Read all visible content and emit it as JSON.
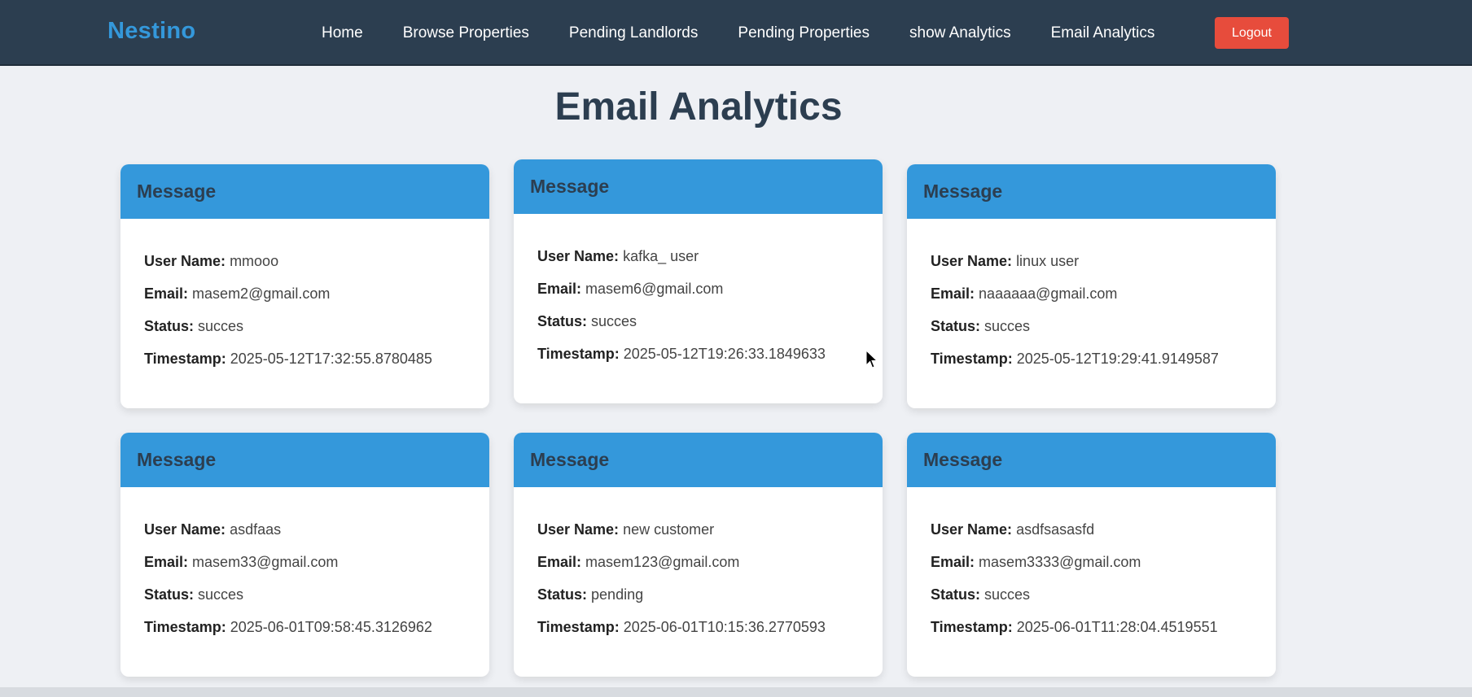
{
  "nav": {
    "brand": "Nestino",
    "links": [
      "Home",
      "Browse Properties",
      "Pending Landlords",
      "Pending Properties",
      "show Analytics",
      "Email Analytics"
    ],
    "logout": "Logout"
  },
  "page": {
    "title": "Email Analytics"
  },
  "labels": {
    "user_name": "User Name:",
    "email": "Email:",
    "status": "Status:",
    "timestamp": "Timestamp:"
  },
  "cards": [
    {
      "header": "Message",
      "user_name": "mmooo",
      "email": "masem2@gmail.com",
      "status": "succes",
      "timestamp": "2025-05-12T17:32:55.8780485"
    },
    {
      "header": "Message",
      "user_name": "kafka_ user",
      "email": "masem6@gmail.com",
      "status": "succes",
      "timestamp": "2025-05-12T19:26:33.1849633"
    },
    {
      "header": "Message",
      "user_name": "linux user",
      "email": "naaaaaa@gmail.com",
      "status": "succes",
      "timestamp": "2025-05-12T19:29:41.9149587"
    },
    {
      "header": "Message",
      "user_name": "asdfaas",
      "email": "masem33@gmail.com",
      "status": "succes",
      "timestamp": "2025-06-01T09:58:45.3126962"
    },
    {
      "header": "Message",
      "user_name": "new customer",
      "email": "masem123@gmail.com",
      "status": "pending",
      "timestamp": "2025-06-01T10:15:36.2770593"
    },
    {
      "header": "Message",
      "user_name": "asdfsasasfd",
      "email": "masem3333@gmail.com",
      "status": "succes",
      "timestamp": "2025-06-01T11:28:04.4519551"
    }
  ]
}
